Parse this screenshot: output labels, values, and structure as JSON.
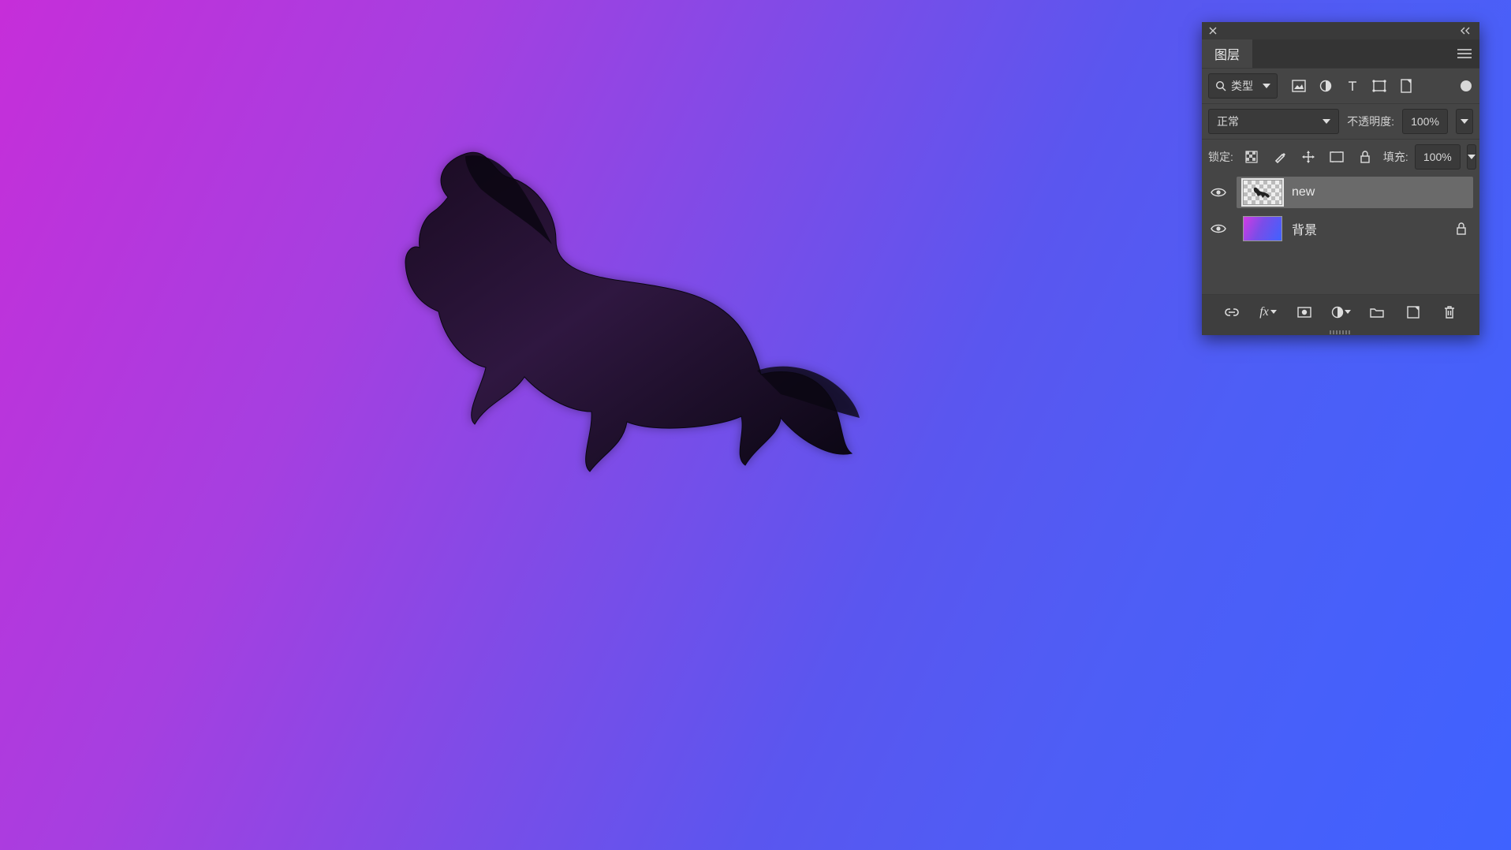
{
  "panel": {
    "tab_title": "图层",
    "filter_label": "类型",
    "blend_mode": "正常",
    "opacity_label": "不透明度:",
    "opacity_value": "100%",
    "lock_label": "锁定:",
    "fill_label": "填充:",
    "fill_value": "100%"
  },
  "layers": [
    {
      "name": "new",
      "visible": true,
      "selected": true,
      "thumb": "transparent-horse",
      "locked": false
    },
    {
      "name": "背景",
      "visible": true,
      "selected": false,
      "thumb": "gradient",
      "locked": true
    }
  ],
  "filter_icons": [
    "image-filter",
    "adjustment-filter",
    "type-filter",
    "shape-filter",
    "smartobject-filter"
  ],
  "lock_icons": [
    "lock-pixels",
    "lock-brush",
    "lock-move",
    "lock-artboard",
    "lock-all"
  ],
  "footer_icons": [
    "link",
    "fx",
    "mask",
    "adjustment",
    "group",
    "new-layer",
    "trash"
  ],
  "colors": {
    "panel_bg": "#454545",
    "accent_gradient_start": "#c62ed9",
    "accent_gradient_end": "#3f62ff"
  }
}
